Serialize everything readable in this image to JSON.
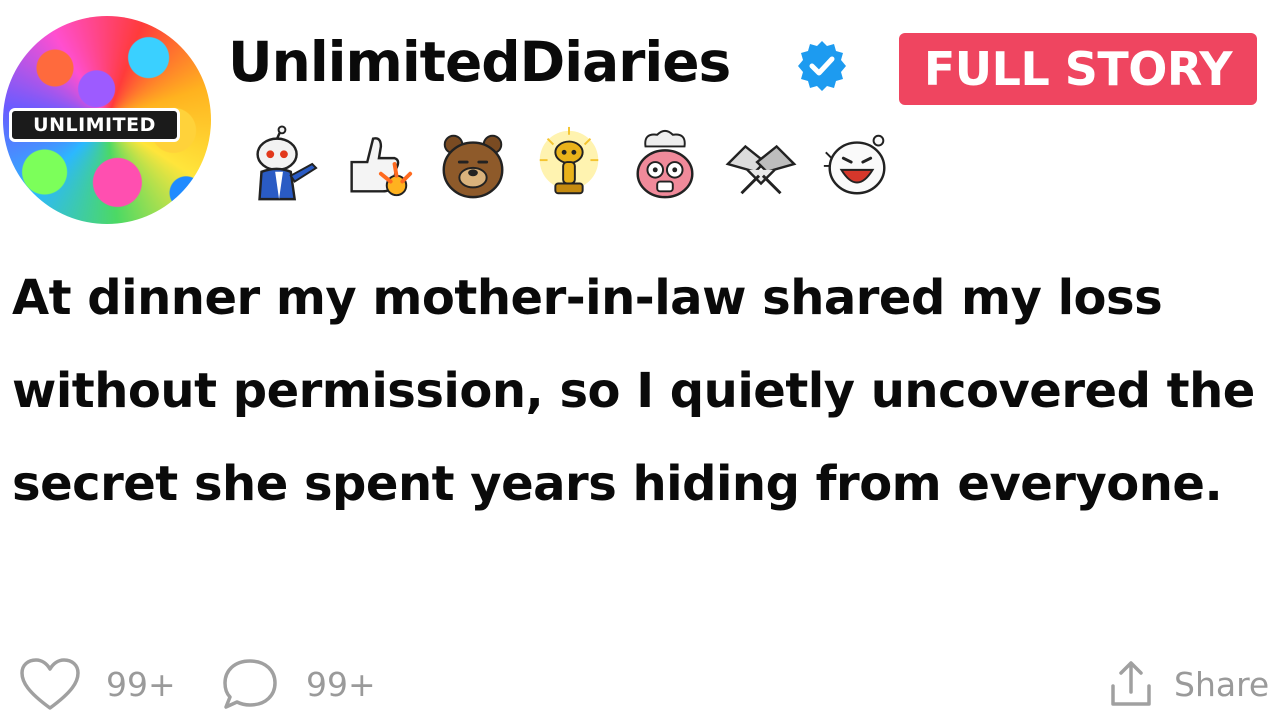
{
  "channel": {
    "avatar_label": "UNLIMITED",
    "name": "UnlimitedDiaries",
    "verified_icon": "verified-badge-icon",
    "badge_color": "#ef4560",
    "verified_color": "#1d9bf0"
  },
  "cta": {
    "label": "FULL STORY"
  },
  "awards": [
    {
      "icon": "snoo-pointing-icon"
    },
    {
      "icon": "thumbs-up-rocket-icon"
    },
    {
      "icon": "bear-face-icon"
    },
    {
      "icon": "gold-snoo-trophy-icon"
    },
    {
      "icon": "mind-blown-icon"
    },
    {
      "icon": "handshake-icon"
    },
    {
      "icon": "laughing-snoo-icon"
    }
  ],
  "post": {
    "title": "At dinner my mother-in-law shared my loss without permission, so I quietly uncovered the secret she spent years hiding from everyone."
  },
  "footer": {
    "likes": "99+",
    "comments": "99+",
    "share_label": "Share"
  }
}
